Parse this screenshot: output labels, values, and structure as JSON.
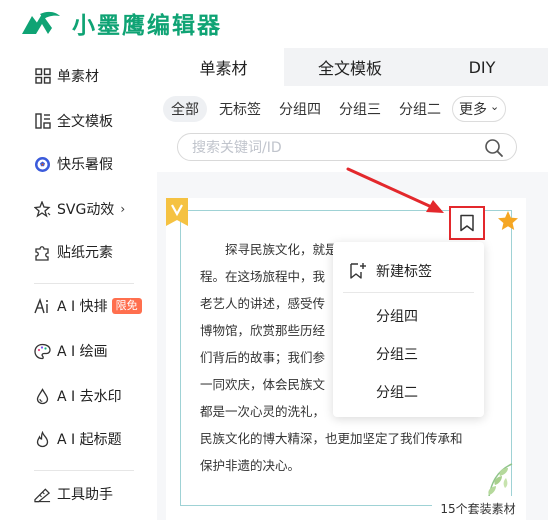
{
  "app": {
    "brand": "小墨鹰编辑器",
    "logo_icon": "eagle-logo-icon",
    "brand_color": "#0fa374"
  },
  "sidebar": {
    "items": [
      {
        "label": "单素材",
        "icon": "grid-icon"
      },
      {
        "label": "全文模板",
        "icon": "template-icon"
      },
      {
        "label": "快乐暑假",
        "icon": "soccer-ball-icon"
      },
      {
        "label": "SVG动效",
        "icon": "sparkle-star-icon",
        "chevron": "›"
      },
      {
        "label": "贴纸元素",
        "icon": "puzzle-icon"
      },
      {
        "label": "A I 快排",
        "icon": "ai-icon",
        "badge": "限免"
      },
      {
        "label": "A I 绘画",
        "icon": "palette-icon"
      },
      {
        "label": "A I 去水印",
        "icon": "droplet-icon"
      },
      {
        "label": "A I 起标题",
        "icon": "flame-icon"
      },
      {
        "label": "工具助手",
        "icon": "ruler-icon"
      }
    ]
  },
  "tabs": [
    {
      "label": "单素材",
      "active": true
    },
    {
      "label": "全文模板",
      "active": false
    },
    {
      "label": "DIY",
      "active": false
    }
  ],
  "chips": [
    {
      "label": "全部",
      "active": true
    },
    {
      "label": "无标签"
    },
    {
      "label": "分组四"
    },
    {
      "label": "分组三"
    },
    {
      "label": "分组二"
    },
    {
      "label": "更多",
      "chevron": "⌄"
    }
  ],
  "search": {
    "placeholder": "搜索关键词/ID"
  },
  "preview": {
    "lines": [
      "探寻民族文化，就是",
      "程。在这场旅程中，我",
      "老艺人的讲述，感受传",
      "博物馆，欣赏那些历经",
      "们背后的故事；我们参",
      "一同欢庆，体会民族文",
      "都是一次心灵的洗礼，",
      "民族文化的博大精深，也更加坚定了我们传承和",
      "保护非遗的决心。"
    ],
    "count_label": "15个套装素材"
  },
  "dropdown": {
    "items": [
      {
        "label": "新建标签",
        "icon": "bookmark-plus-icon"
      },
      {
        "label": "分组四"
      },
      {
        "label": "分组三"
      },
      {
        "label": "分组二"
      }
    ]
  },
  "colors": {
    "highlight": "#e3282c",
    "star": "#f5a623",
    "frame": "#9fd2d5"
  }
}
